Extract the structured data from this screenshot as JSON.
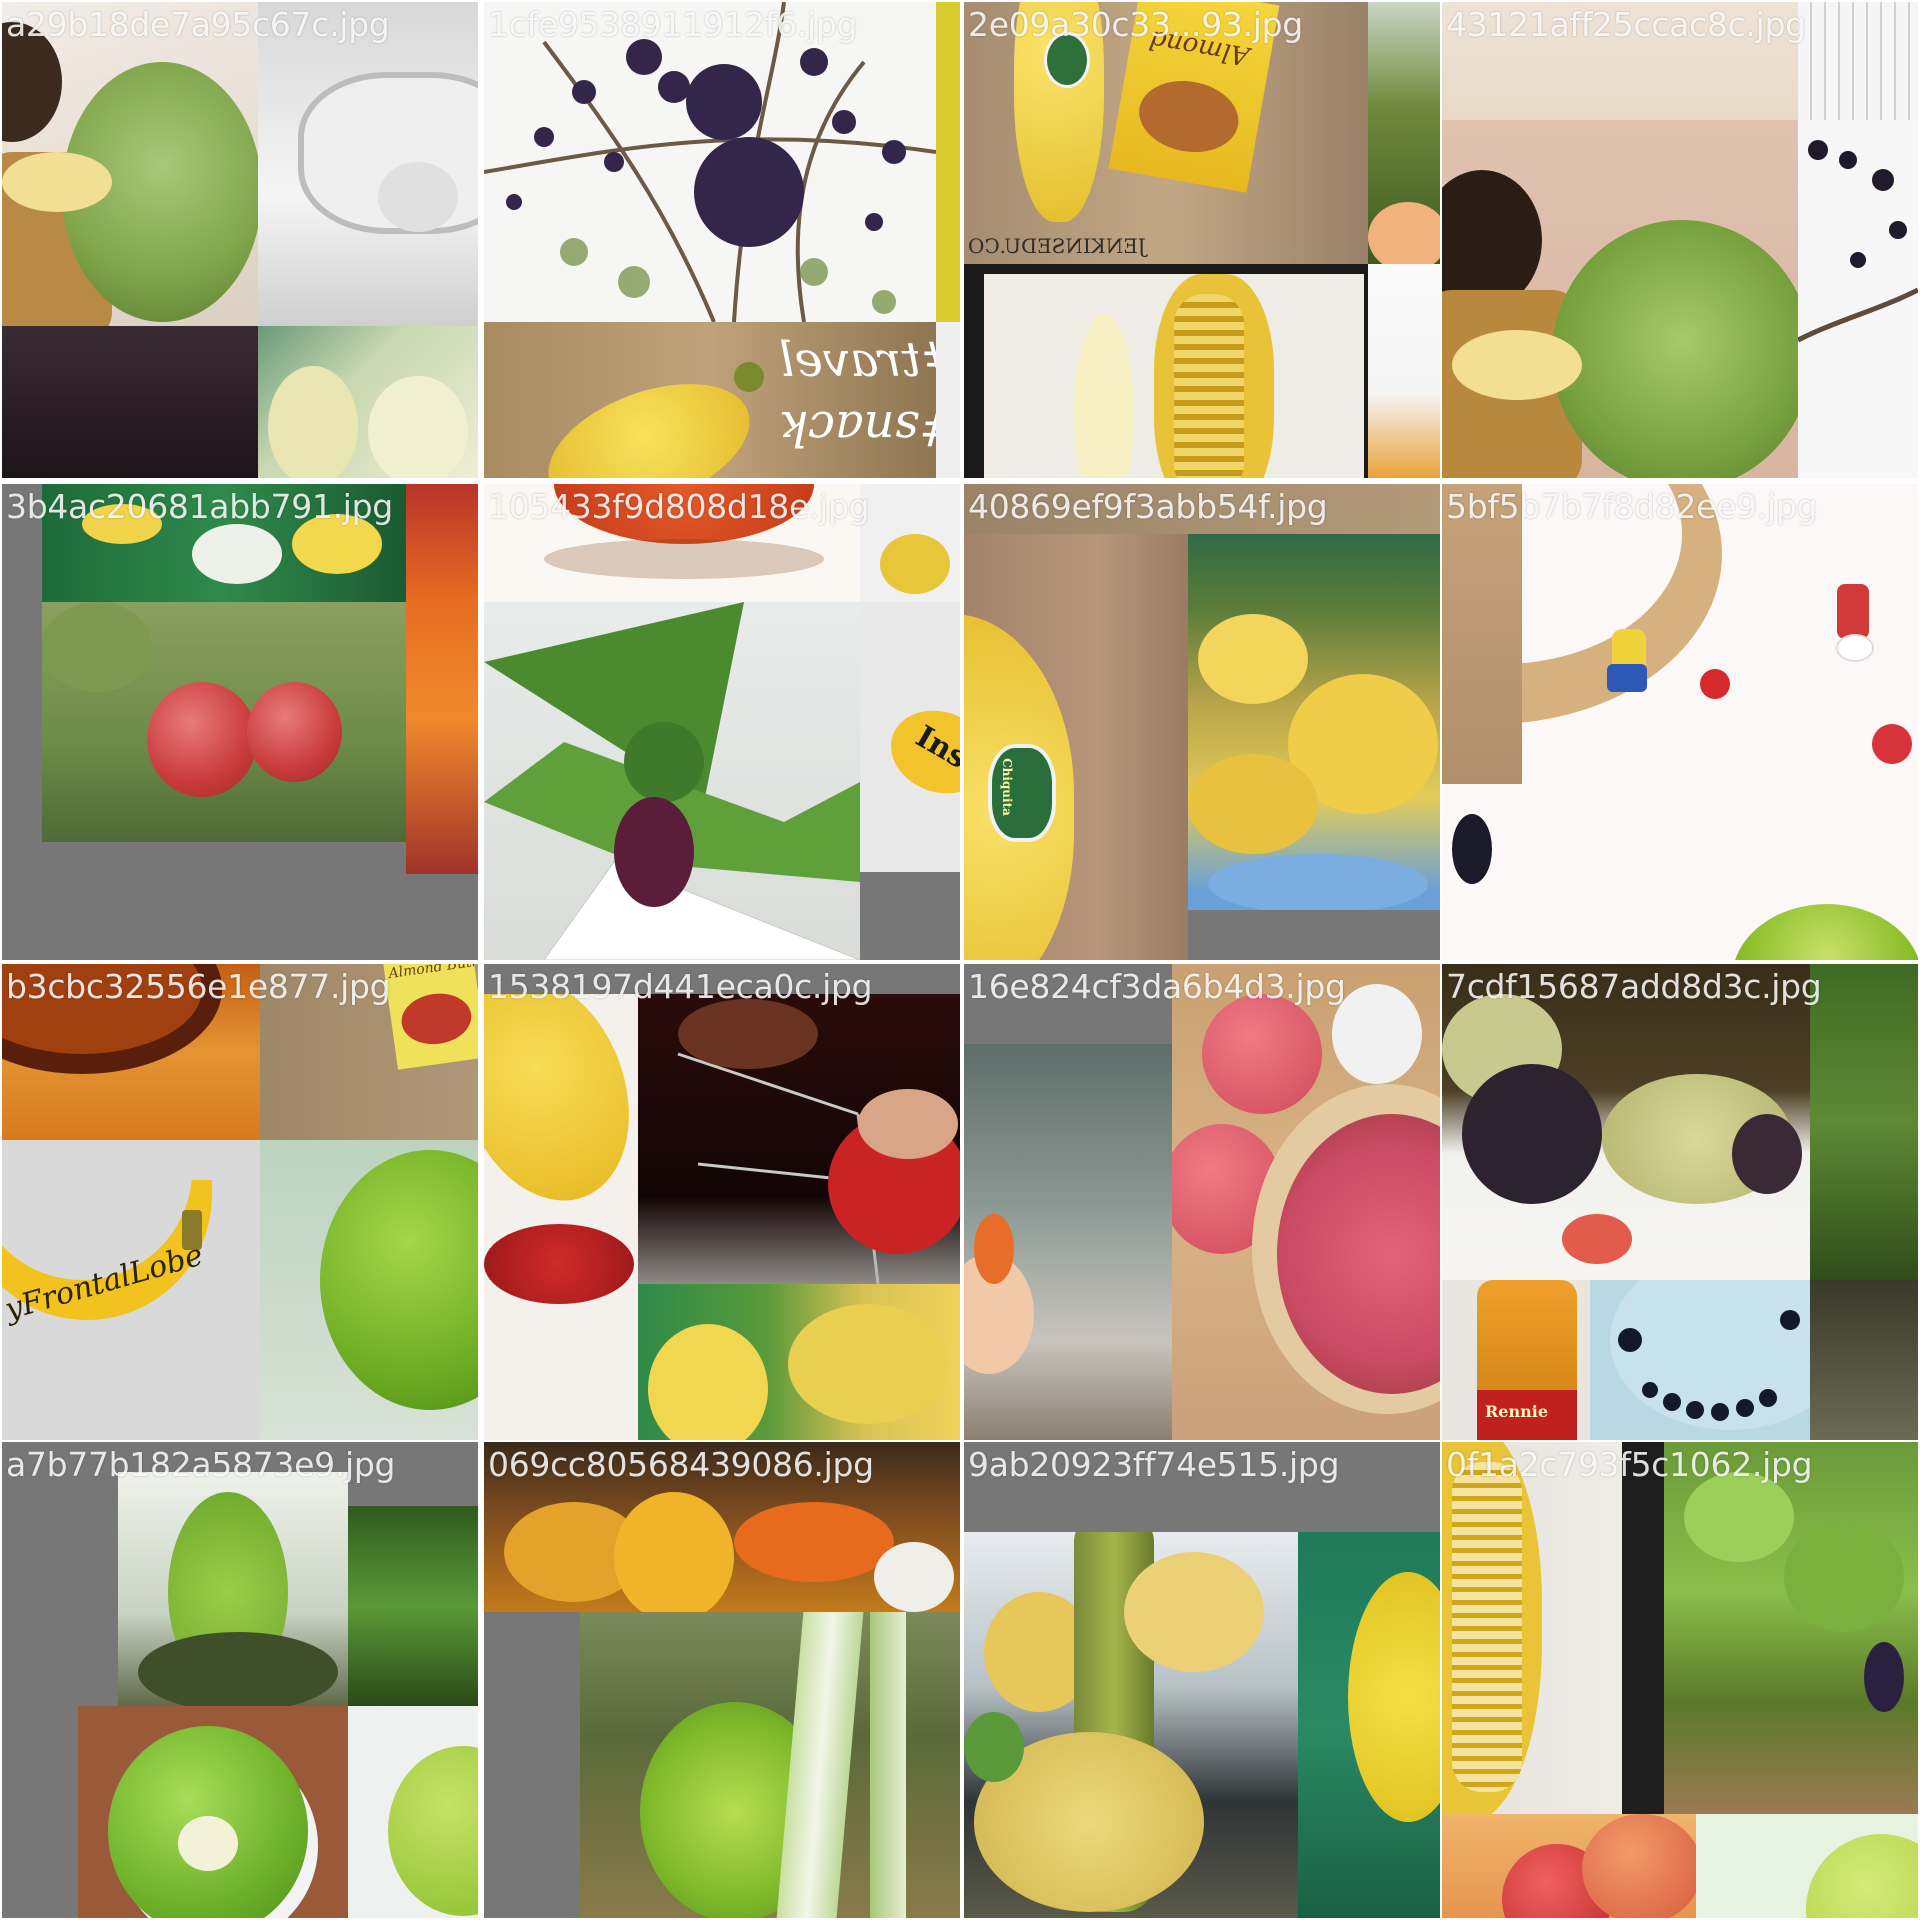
{
  "tiles": [
    {
      "filename": "a29b18de7a95c67c.jpg"
    },
    {
      "filename": "1cfe9538911912f6.jpg"
    },
    {
      "filename": "2e09a30c33...93.jpg"
    },
    {
      "filename": "43121aff25ccac8c.jpg"
    },
    {
      "filename": "3b4ac20681abb791.jpg"
    },
    {
      "filename": "105433f9d808d18e.jpg"
    },
    {
      "filename": "40869ef9f3abb54f.jpg"
    },
    {
      "filename": "5bf5b7b7f8d82ee9.jpg"
    },
    {
      "filename": "b3cbc32556e1e877.jpg"
    },
    {
      "filename": "1538197d441eca0c.jpg"
    },
    {
      "filename": "16e824cf3da6b4d3.jpg"
    },
    {
      "filename": "7cdf15687add8d3c.jpg"
    },
    {
      "filename": "a7b77b182a5873e9.jpg"
    },
    {
      "filename": "069cc80568439086.jpg"
    },
    {
      "filename": "9ab20923ff74e515.jpg"
    },
    {
      "filename": "0f1a2c793f5c1062.jpg"
    }
  ],
  "photo_text": {
    "travel_tag": "#travel",
    "snack_tag": "#snack",
    "jenkins_mark": "JENKINSEDU.CO",
    "almond_butter": "Almond Butter",
    "almond_short": "Almond",
    "chiquita": "Chiquita",
    "frontal_lobe": "yFrontalLobe",
    "banana_sign": "Ins",
    "bottle_label": "Rennie"
  }
}
